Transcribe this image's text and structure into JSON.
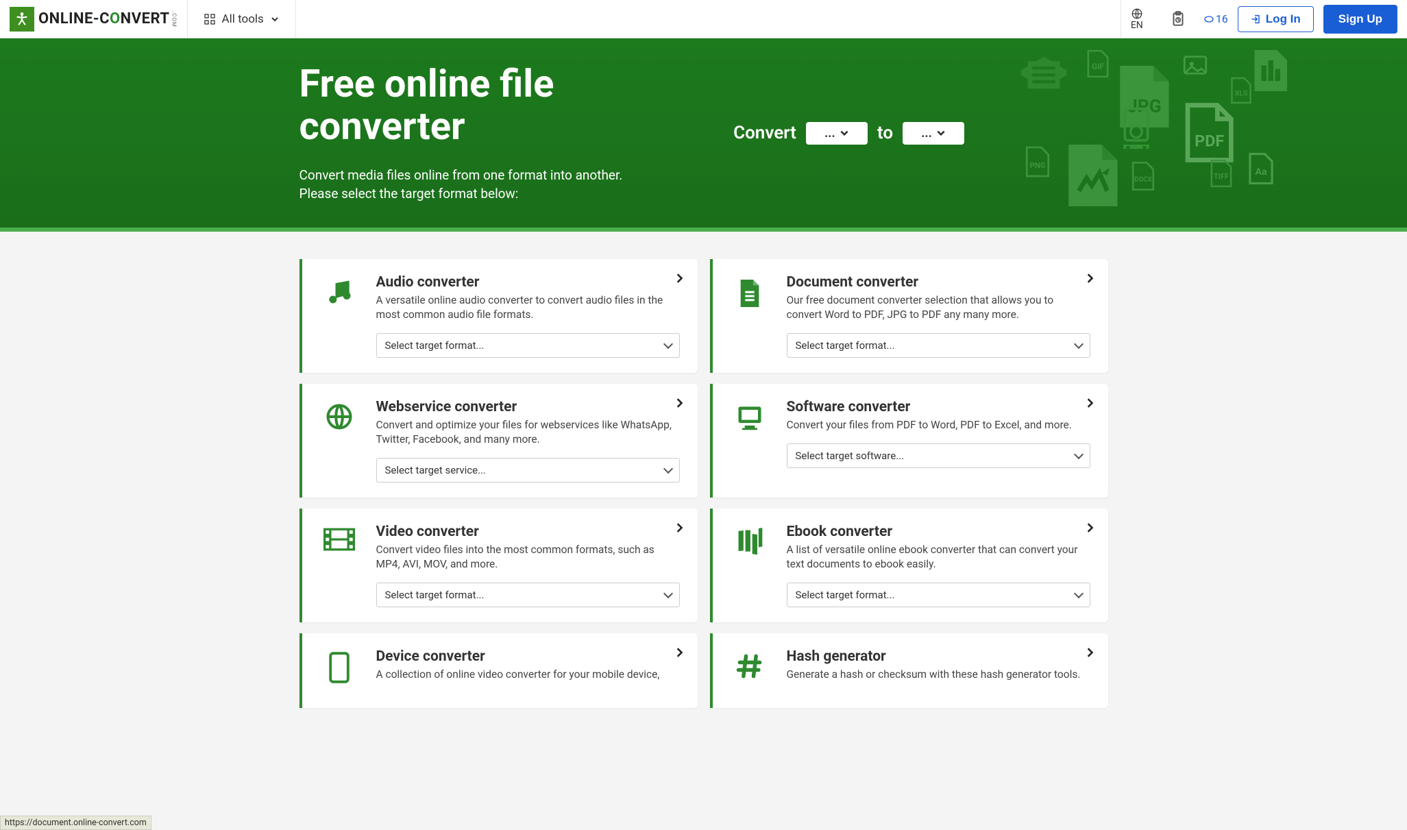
{
  "header": {
    "logo_text_pre": "ONLINE-C",
    "logo_text_mid": "O",
    "logo_text_post": "NVERT",
    "logo_com": ".COM",
    "all_tools": "All tools",
    "lang": "EN",
    "minutes": "16",
    "login": "Log In",
    "signup": "Sign Up"
  },
  "hero": {
    "title": "Free online file converter",
    "subtitle": "Convert media files online from one format into another. Please select the target format below:",
    "convert_label": "Convert",
    "to_label": "to",
    "from_value": "...",
    "to_value": "..."
  },
  "cards": [
    {
      "icon": "music",
      "title": "Audio converter",
      "desc": "A versatile online audio converter to convert audio files in the most common audio file formats.",
      "placeholder": "Select target format..."
    },
    {
      "icon": "document",
      "title": "Document converter",
      "desc": "Our free document converter selection that allows you to convert Word to PDF, JPG to PDF any many more.",
      "placeholder": "Select target format..."
    },
    {
      "icon": "globe",
      "title": "Webservice converter",
      "desc": "Convert and optimize your files for webservices like WhatsApp, Twitter, Facebook, and many more.",
      "placeholder": "Select target service..."
    },
    {
      "icon": "software",
      "title": "Software converter",
      "desc": "Convert your files from PDF to Word, PDF to Excel, and more.",
      "placeholder": "Select target software..."
    },
    {
      "icon": "video",
      "title": "Video converter",
      "desc": "Convert video files into the most common formats, such as MP4, AVI, MOV, and more.",
      "placeholder": "Select target format..."
    },
    {
      "icon": "ebook",
      "title": "Ebook converter",
      "desc": "A list of versatile online ebook converter that can convert your text documents to ebook easily.",
      "placeholder": "Select target format..."
    },
    {
      "icon": "device",
      "title": "Device converter",
      "desc": "A collection of online video converter for your mobile device,",
      "placeholder": ""
    },
    {
      "icon": "hash",
      "title": "Hash generator",
      "desc": "Generate a hash or checksum with these hash generator tools.",
      "placeholder": ""
    }
  ],
  "status_url": "https://document.online-convert.com"
}
